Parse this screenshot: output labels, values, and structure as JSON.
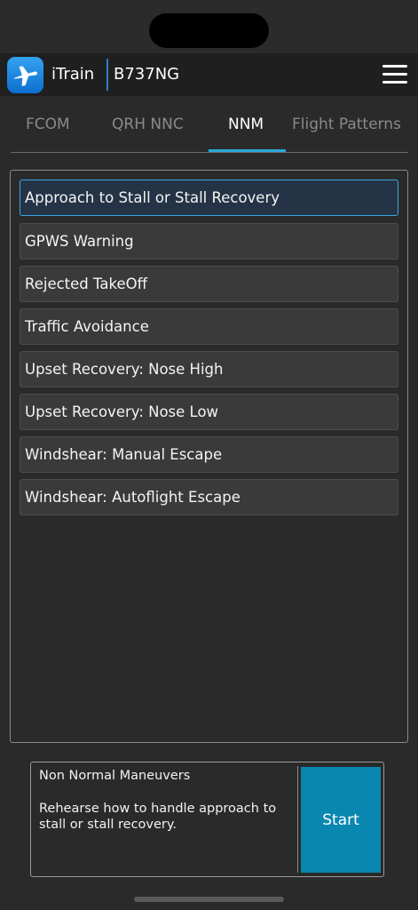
{
  "header": {
    "app_name": "iTrain",
    "aircraft": "B737NG"
  },
  "tabs": [
    {
      "label": "FCOM",
      "active": false
    },
    {
      "label": "QRH NNC",
      "active": false
    },
    {
      "label": "NNM",
      "active": true
    },
    {
      "label": "Flight Patterns",
      "active": false
    }
  ],
  "maneuvers": [
    {
      "label": "Approach to Stall or Stall Recovery",
      "selected": true
    },
    {
      "label": "GPWS Warning",
      "selected": false
    },
    {
      "label": "Rejected TakeOff",
      "selected": false
    },
    {
      "label": "Traffic Avoidance",
      "selected": false
    },
    {
      "label": "Upset Recovery: Nose High",
      "selected": false
    },
    {
      "label": "Upset Recovery: Nose Low",
      "selected": false
    },
    {
      "label": "Windshear: Manual Escape",
      "selected": false
    },
    {
      "label": "Windshear: Autoflight Escape",
      "selected": false
    }
  ],
  "card": {
    "title": "Non Normal Maneuvers",
    "description": "Rehearse how to handle approach to stall or stall recovery.",
    "start_label": "Start"
  },
  "colors": {
    "accent": "#2aa8d8",
    "start_button": "#0a87b0",
    "selected_border": "#3aa7e0"
  },
  "icons": {
    "app": "airplane-icon",
    "menu": "hamburger-menu-icon"
  }
}
